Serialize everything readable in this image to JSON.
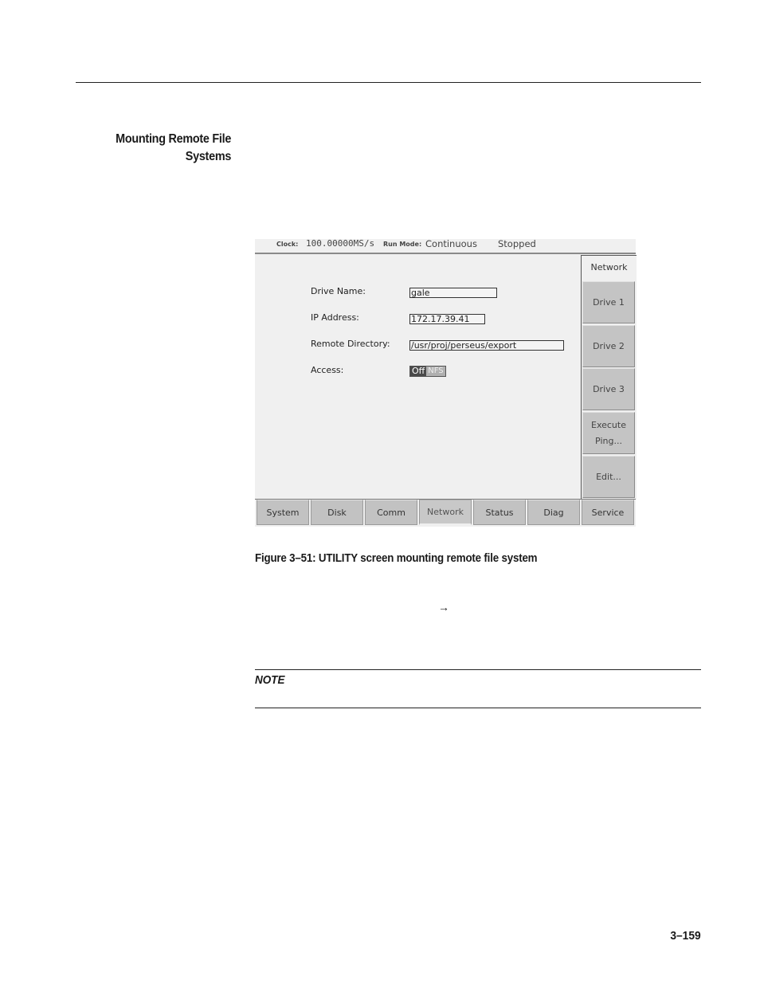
{
  "section": {
    "heading_line1": "Mounting Remote File",
    "heading_line2": "Systems"
  },
  "screen": {
    "status_bar": {
      "clock_label": "Clock:",
      "clock_value": "100.00000MS/s",
      "run_mode_label": "Run Mode:",
      "run_mode_value": "Continuous",
      "state": "Stopped"
    },
    "form": {
      "drive_name_label": "Drive Name:",
      "drive_name_value": "gale",
      "ip_address_label": "IP Address:",
      "ip_address_value": "172.17.39.41",
      "remote_directory_label": "Remote Directory:",
      "remote_directory_value": "/usr/proj/perseus/export",
      "access_label": "Access:",
      "access_options": [
        "Off",
        "NFS"
      ],
      "access_selected": "Off"
    },
    "side_panel": {
      "title": "Network",
      "buttons": [
        {
          "label": "Drive 1"
        },
        {
          "label": "Drive 2"
        },
        {
          "label": "Drive 3"
        },
        {
          "label_line1": "Execute",
          "label_line2": "Ping..."
        },
        {
          "label": "Edit..."
        }
      ]
    },
    "tabs": [
      {
        "label": "System"
      },
      {
        "label": "Disk"
      },
      {
        "label": "Comm"
      },
      {
        "label": "Network",
        "active": true
      },
      {
        "label": "Status"
      },
      {
        "label": "Diag"
      },
      {
        "label": "Service"
      }
    ]
  },
  "figure_caption": "Figure 3–51: UTILITY screen mounting remote file system",
  "arrow_glyph": "→",
  "note_label": "NOTE",
  "page_number": "3–159"
}
